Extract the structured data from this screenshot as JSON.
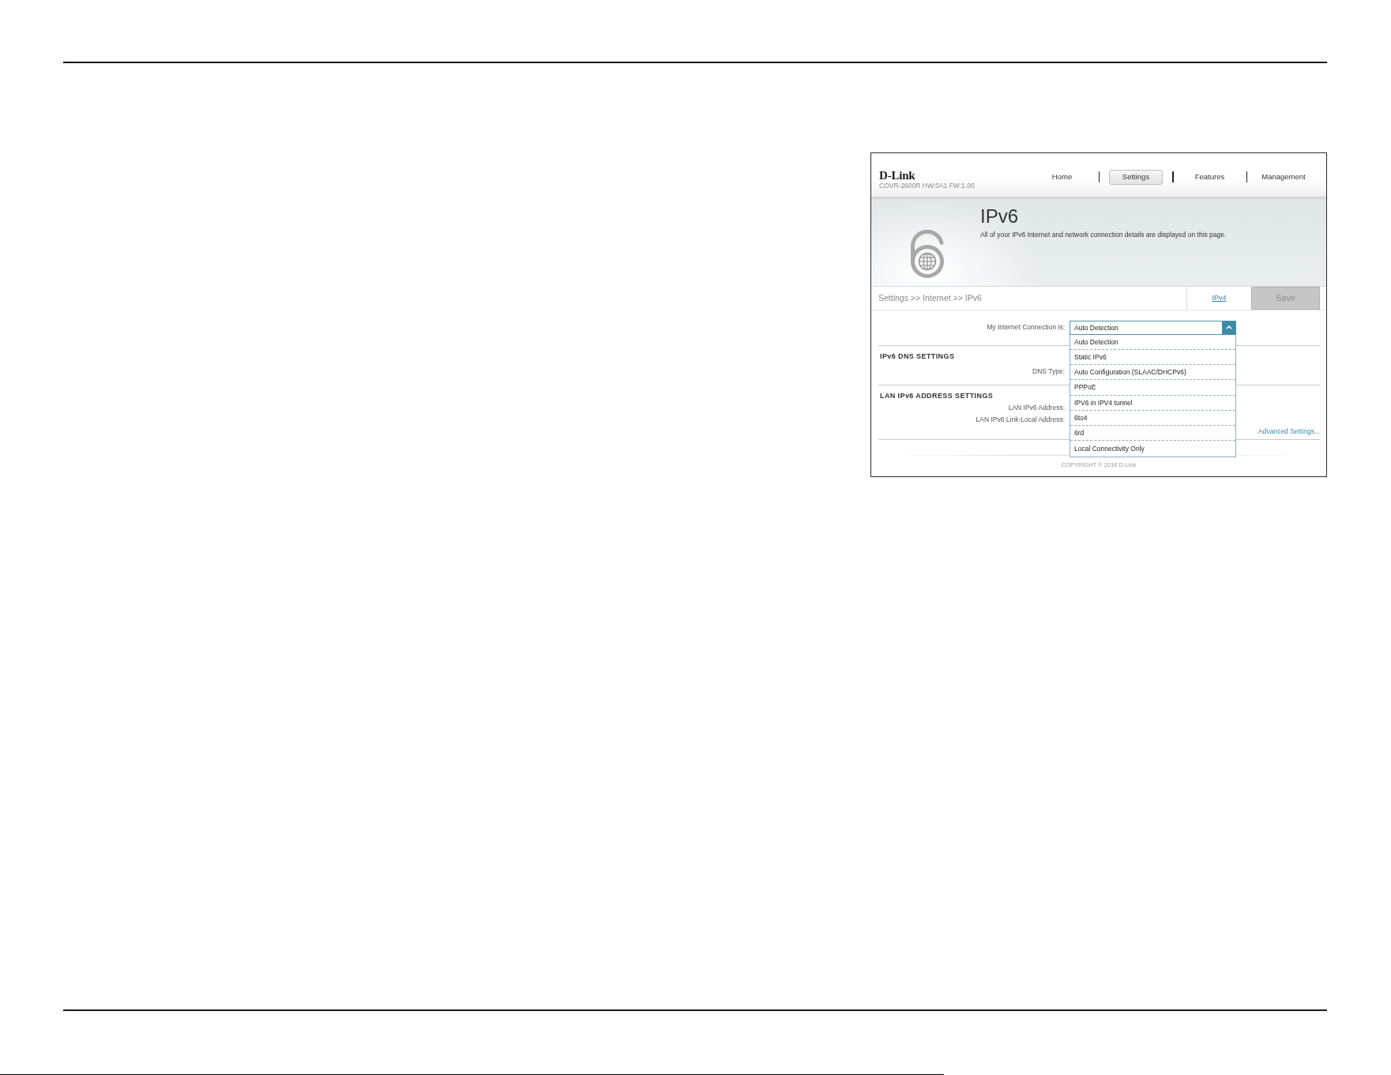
{
  "router_ui": {
    "header": {
      "logo": "D-Link",
      "model": "COVR-2600R HW:0A1 FW:1.00",
      "nav": [
        {
          "label": "Home",
          "selected": false
        },
        {
          "label": "Settings",
          "selected": true
        },
        {
          "label": "Features",
          "selected": false
        },
        {
          "label": "Management",
          "selected": false
        }
      ]
    },
    "banner": {
      "title": "IPv6",
      "description": "All of your IPv6 Internet and network connection details are displayed on this page."
    },
    "breadcrumb": "Settings >> Internet >> IPv6",
    "actions": [
      {
        "kind": "link",
        "label": "IPv4"
      },
      {
        "kind": "button",
        "label": "Save",
        "disabled": true
      }
    ],
    "connection": {
      "label": "My Internet Connection is:",
      "value": "Auto Detection",
      "expanded": true,
      "options": [
        {
          "label": "Auto Detection"
        },
        {
          "label": "Static IPv6"
        },
        {
          "label": "Auto Configuration (SLAAC/DHCPv6)"
        },
        {
          "label": "PPPoE"
        },
        {
          "label": "IPV6 in IPV4 tunnel"
        },
        {
          "label": "6to4"
        },
        {
          "label": "6rd"
        },
        {
          "label": "Local Connectivity Only"
        }
      ]
    },
    "sections": [
      {
        "title": "IPv6 DNS SETTINGS",
        "fields": [
          {
            "label": "DNS Type:"
          }
        ]
      },
      {
        "title": "LAN IPv6 ADDRESS SETTINGS",
        "fields": [
          {
            "label": "LAN IPv6 Address:"
          },
          {
            "label": "LAN IPv6 Link-Local Address:"
          }
        ],
        "link": "Advanced Settings..."
      }
    ],
    "footer": "COPYRIGHT © 2016 D-Link"
  }
}
